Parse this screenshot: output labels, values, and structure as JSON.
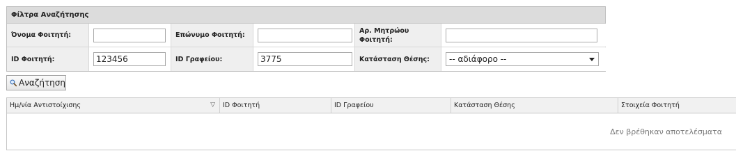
{
  "filters": {
    "header": "Φίλτρα Αναζήτησης",
    "row1": {
      "name_label": "Όνομα Φοιτητή:",
      "name_value": "",
      "surname_label": "Επώνυμο Φοιτητή:",
      "surname_value": "",
      "registry_label": "Αρ. Μητρώου Φοιτητή:",
      "registry_value": ""
    },
    "row2": {
      "student_id_label": "ID Φοιτητή:",
      "student_id_value": "123456",
      "office_id_label": "ID Γραφείου:",
      "office_id_value": "3775",
      "status_label": "Κατάσταση Θέσης:",
      "status_value": "-- αδιάφορο --"
    }
  },
  "search_button": {
    "label": "Αναζήτηση",
    "icon": "magnifier-icon"
  },
  "results": {
    "columns": [
      "Ημ/νία Αντιστοίχισης",
      "ID Φοιτητή",
      "ID Γραφείου",
      "Κατάσταση Θέσης",
      "Στοιχεία Φοιτητή"
    ],
    "sort_indicator": "▽",
    "empty_message": "Δεν βρέθηκαν αποτελέσματα"
  }
}
